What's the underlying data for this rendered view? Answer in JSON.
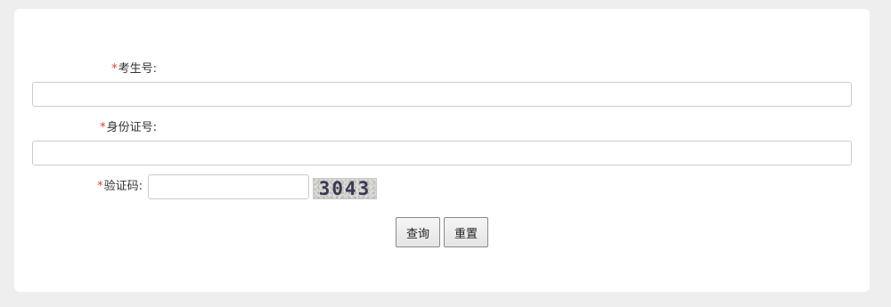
{
  "form": {
    "required_mark": "*",
    "exam_number": {
      "label": "考生号:",
      "value": "",
      "placeholder": ""
    },
    "id_number": {
      "label": "身份证号:",
      "value": "",
      "placeholder": ""
    },
    "captcha": {
      "label": "验证码:",
      "value": "",
      "placeholder": "",
      "image_text": "3043"
    },
    "buttons": {
      "query_label": "查询",
      "reset_label": "重置"
    }
  }
}
